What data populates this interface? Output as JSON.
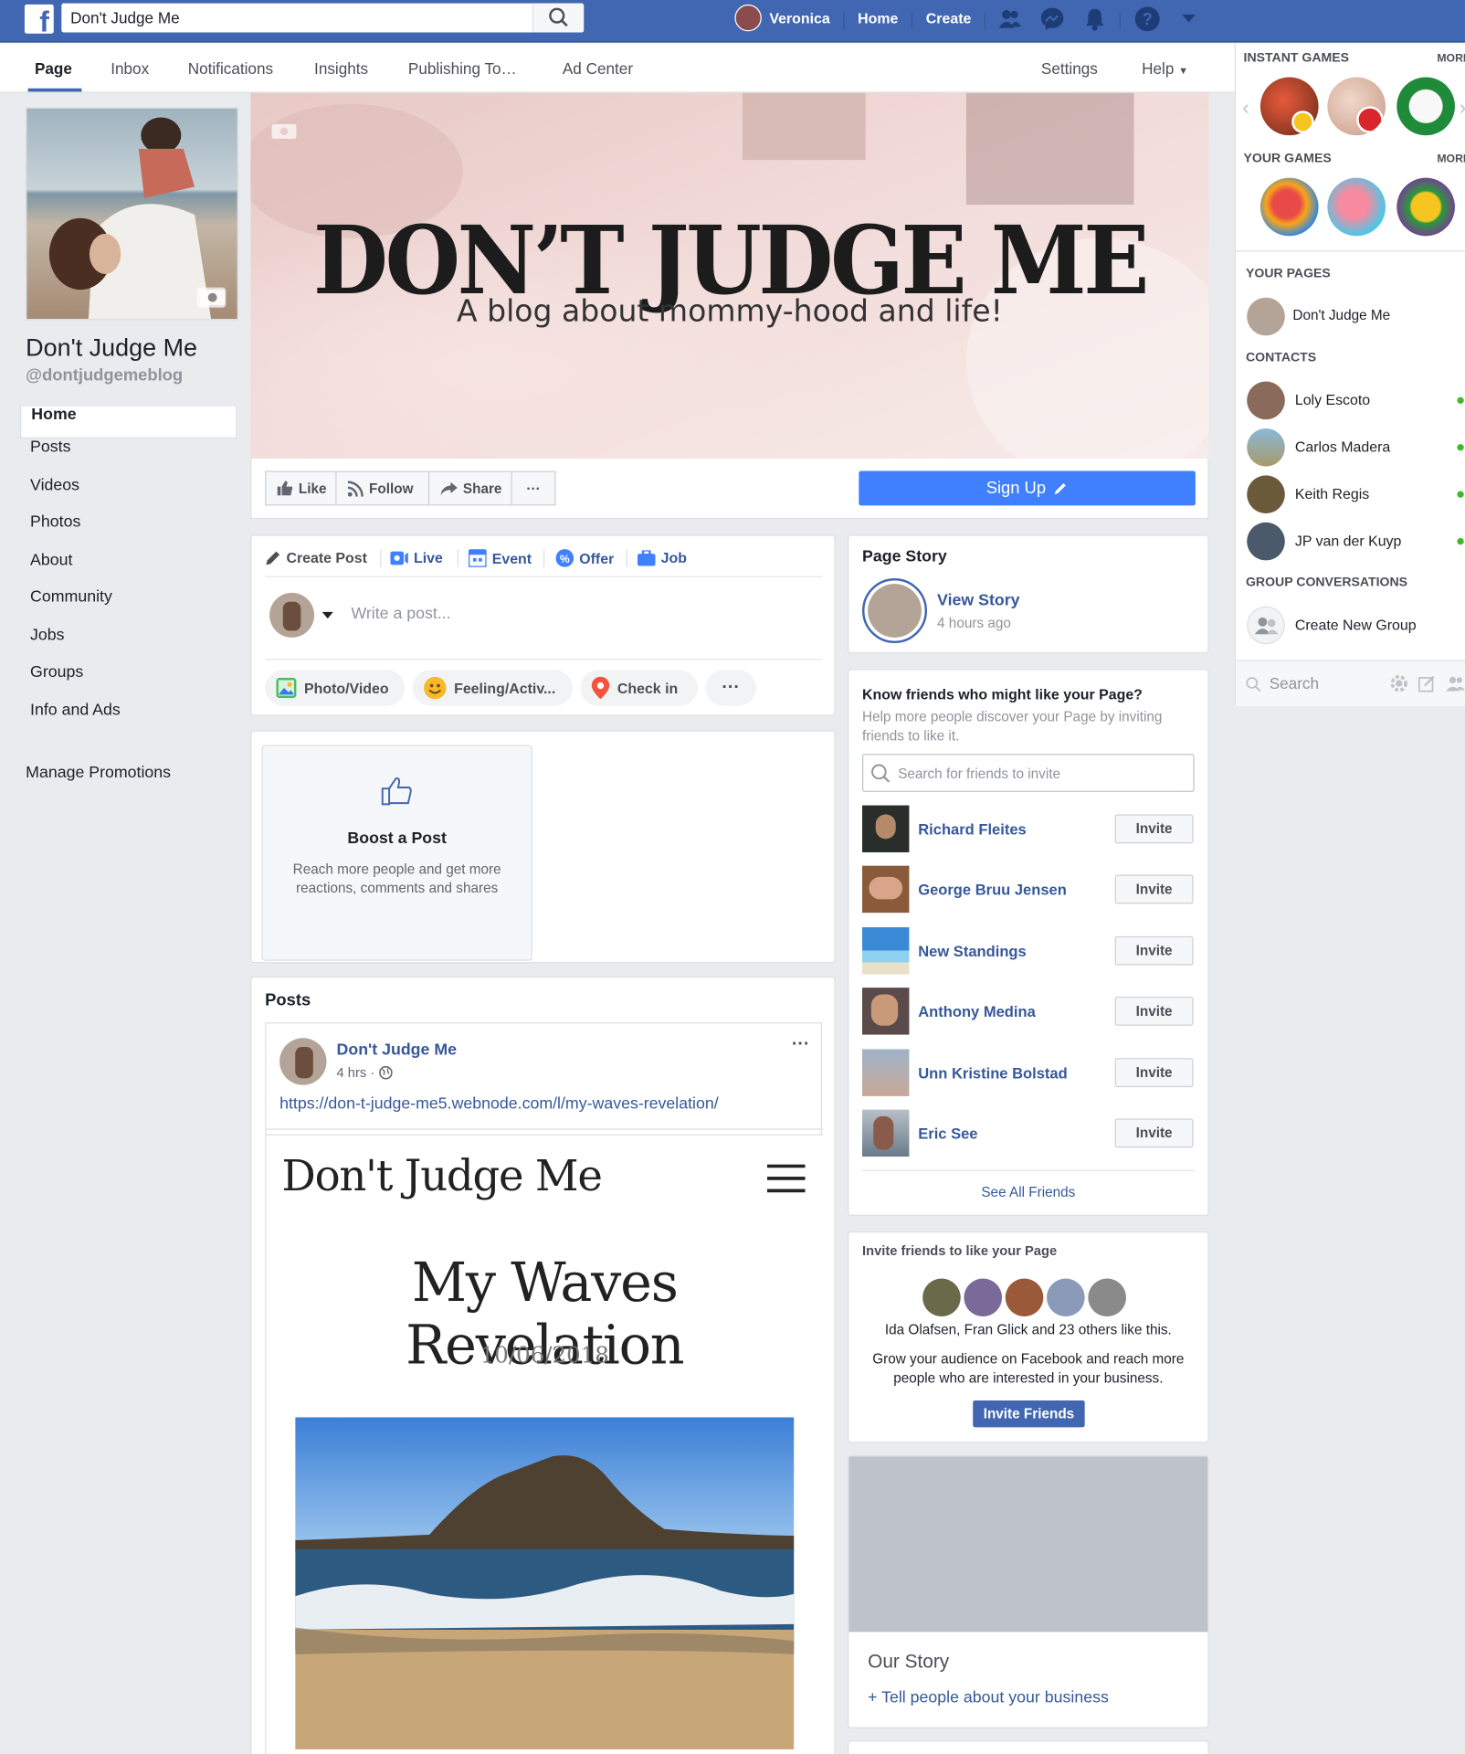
{
  "topbar": {
    "logo": "f",
    "search_value": "Don't Judge Me",
    "user_name": "Veronica",
    "home": "Home",
    "create": "Create",
    "icons": [
      "friends-icon",
      "messenger-icon",
      "notifications-icon",
      "help-icon",
      "chevron-down-icon"
    ]
  },
  "page_tabs": {
    "page": "Page",
    "inbox": "Inbox",
    "notifications": "Notifications",
    "insights": "Insights",
    "publishing": "Publishing To…",
    "ad_center": "Ad Center",
    "settings": "Settings",
    "help": "Help"
  },
  "profile": {
    "name": "Don't Judge Me",
    "handle": "@dontjudgemeblog"
  },
  "left_nav": {
    "items": [
      "Home",
      "Posts",
      "Videos",
      "Photos",
      "About",
      "Community",
      "Jobs",
      "Groups",
      "Info and Ads"
    ],
    "manage_promotions": "Manage Promotions"
  },
  "cover": {
    "title": "DON’T JUDGE ME",
    "subtitle": "A blog about mommy-hood and life!"
  },
  "actions": {
    "like": "Like",
    "follow": "Follow",
    "share": "Share",
    "more": "···",
    "signup": "Sign Up"
  },
  "composer": {
    "create_post": "Create Post",
    "live": "Live",
    "event": "Event",
    "offer": "Offer",
    "job": "Job",
    "placeholder": "Write a post...",
    "photo_video": "Photo/Video",
    "feeling": "Feeling/Activ...",
    "checkin": "Check in",
    "more": "···"
  },
  "boost": {
    "title": "Boost a Post",
    "desc": "Reach more people and get more reactions, comments and shares"
  },
  "posts": {
    "header": "Posts",
    "author": "Don't Judge Me",
    "time": "4 hrs ·",
    "link": "https://don-t-judge-me5.webnode.com/l/my-waves-revelation/",
    "preview_site": "Don't Judge Me",
    "preview_title": "My Waves Revelation",
    "preview_date": "10/06/2018"
  },
  "page_story": {
    "header": "Page Story",
    "view": "View Story",
    "time": "4 hours ago"
  },
  "know_friends": {
    "header": "Know friends who might like your Page?",
    "desc": "Help more people discover your Page by inviting friends to like it.",
    "search_placeholder": "Search for friends to invite",
    "friends": [
      {
        "name": "Richard Fleites",
        "button": "Invite"
      },
      {
        "name": "George Bruu Jensen",
        "button": "Invite"
      },
      {
        "name": "New Standings",
        "button": "Invite"
      },
      {
        "name": "Anthony Medina",
        "button": "Invite"
      },
      {
        "name": "Unn Kristine Bolstad",
        "button": "Invite"
      },
      {
        "name": "Eric See",
        "button": "Invite"
      }
    ],
    "see_all": "See All Friends"
  },
  "invite_card": {
    "header": "Invite friends to like your Page",
    "likes": "Ida Olafsen, Fran Glick and 23 others like this.",
    "grow": "Grow your audience on Facebook and reach more people who are interested in your business.",
    "button": "Invite Friends"
  },
  "our_story": {
    "title": "Our Story",
    "link": "+ Tell people about your business"
  },
  "sidebar": {
    "instant_games": "INSTANT GAMES",
    "your_games": "YOUR GAMES",
    "more": "MORE",
    "your_pages": "YOUR PAGES",
    "page_item": "Don't Judge Me",
    "contacts": "CONTACTS",
    "contact_list": [
      "Loly Escoto",
      "Carlos Madera",
      "Keith Regis",
      "JP van der Kuyp"
    ],
    "group_conversations": "GROUP CONVERSATIONS",
    "create_group": "Create New Group",
    "search_placeholder": "Search"
  },
  "colors": {
    "brand": "#4267b2",
    "link": "#365899",
    "signup": "#4080ff",
    "online": "#42b72a"
  }
}
